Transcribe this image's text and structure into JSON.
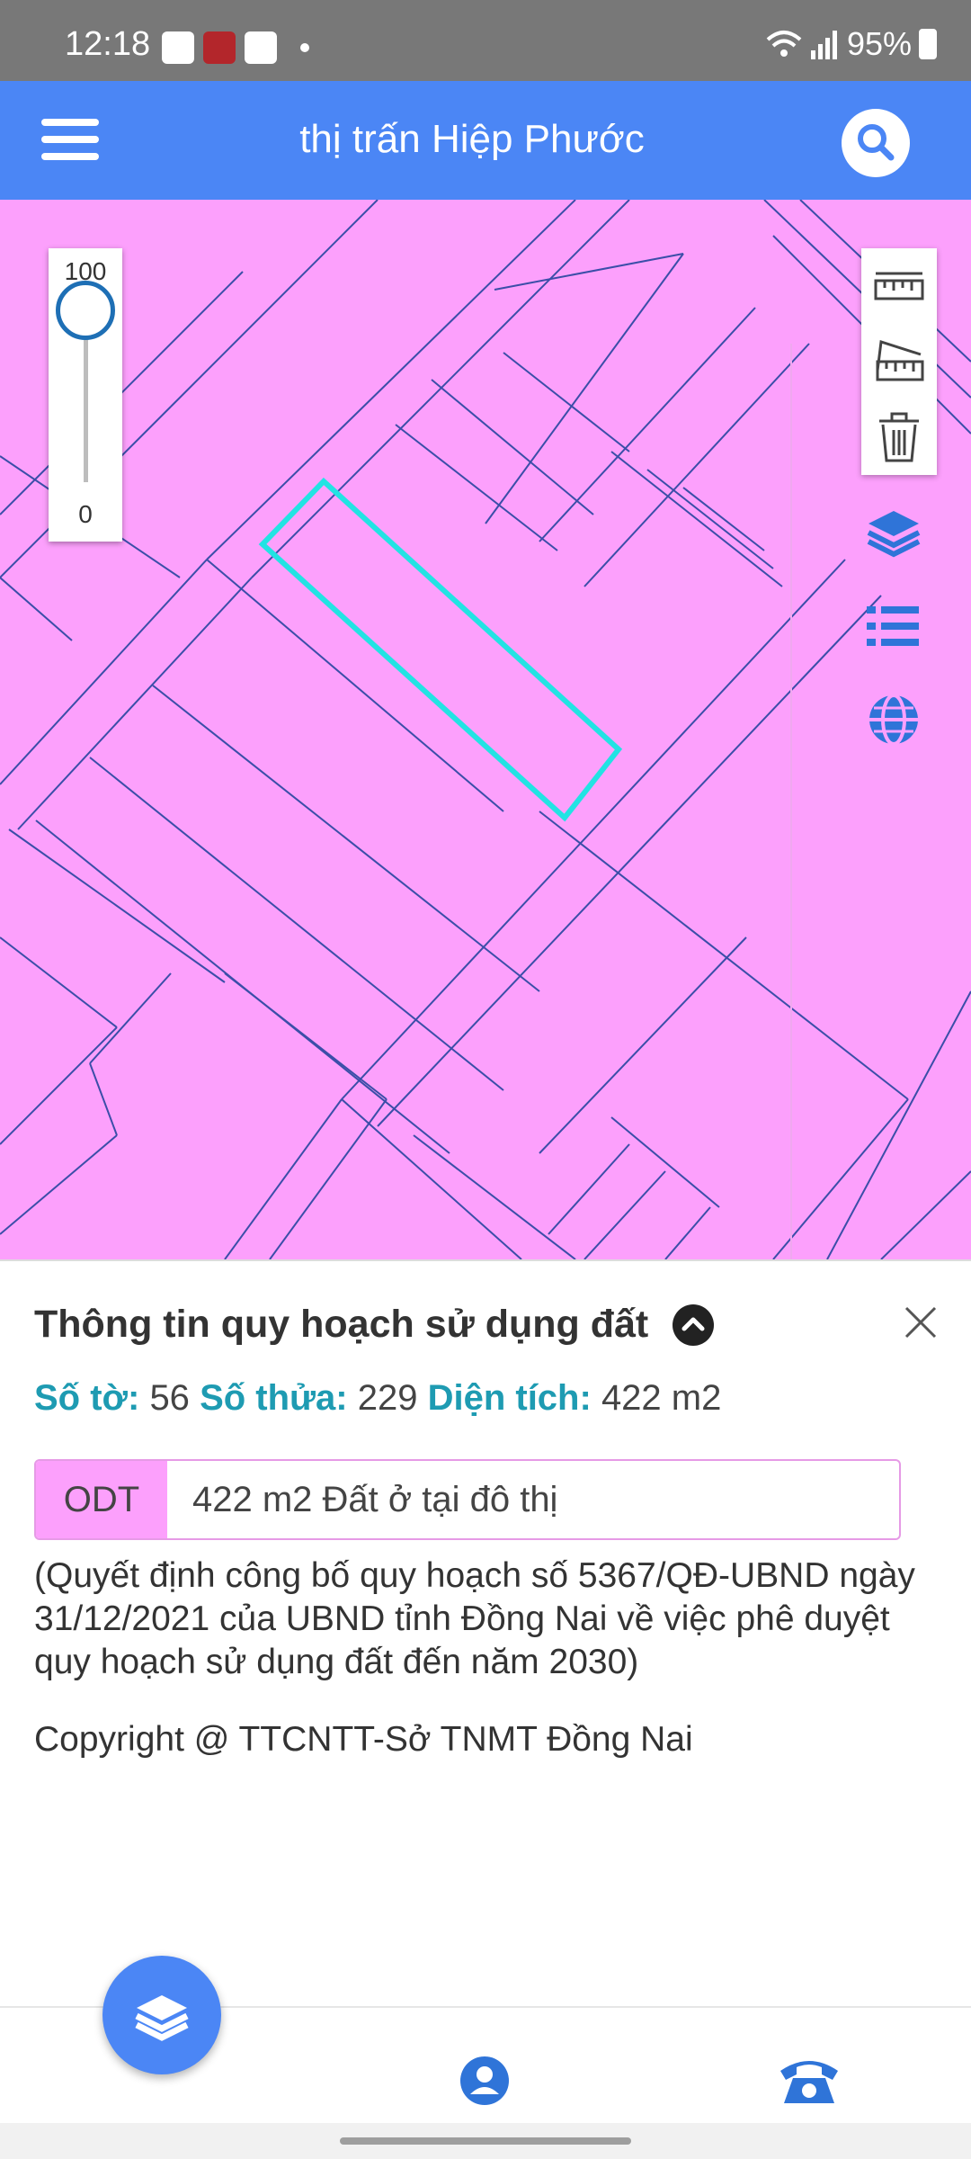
{
  "status_bar": {
    "time": "12:18",
    "battery": "95%"
  },
  "header": {
    "title": "thị trấn Hiệp Phước",
    "menu_icon": "hamburger-menu-icon",
    "search_icon": "search-icon",
    "color": "#4b86f5"
  },
  "map": {
    "land_use_color": "#fca0fc",
    "parcel_line_color": "#3b4ea8",
    "selected_parcel_color": "#22e3e3",
    "opacity_slider": {
      "max_label": "100",
      "min_label": "0",
      "value": 100
    },
    "tools": [
      "measure-distance-icon",
      "measure-area-icon",
      "trash-icon"
    ],
    "side_buttons": [
      "layers-icon",
      "list-icon",
      "globe-icon"
    ]
  },
  "info": {
    "title": "Thông tin quy hoạch sử dụng đất",
    "sheet_label": "Số tờ:",
    "sheet_value": "56",
    "parcel_label": "Số thửa:",
    "parcel_value": "229",
    "area_label": "Diện tích:",
    "area_value": "422 m2",
    "zone_code": "ODT",
    "zone_description": "422 m2 Đất ở tại đô thị",
    "decision_text": "(Quyết định công bố quy hoạch số 5367/QĐ-UBND ngày 31/12/2021 của UBND tỉnh Đồng Nai về việc phê duyệt quy hoạch sử dụng đất đến năm 2030)",
    "copyright": "Copyright @ TTCNTT-Sở TNMT Đồng Nai",
    "accent_color": "#1e9bb2"
  },
  "bottom_nav": {
    "items": [
      "layers-icon",
      "user-icon",
      "phone-icon"
    ]
  }
}
